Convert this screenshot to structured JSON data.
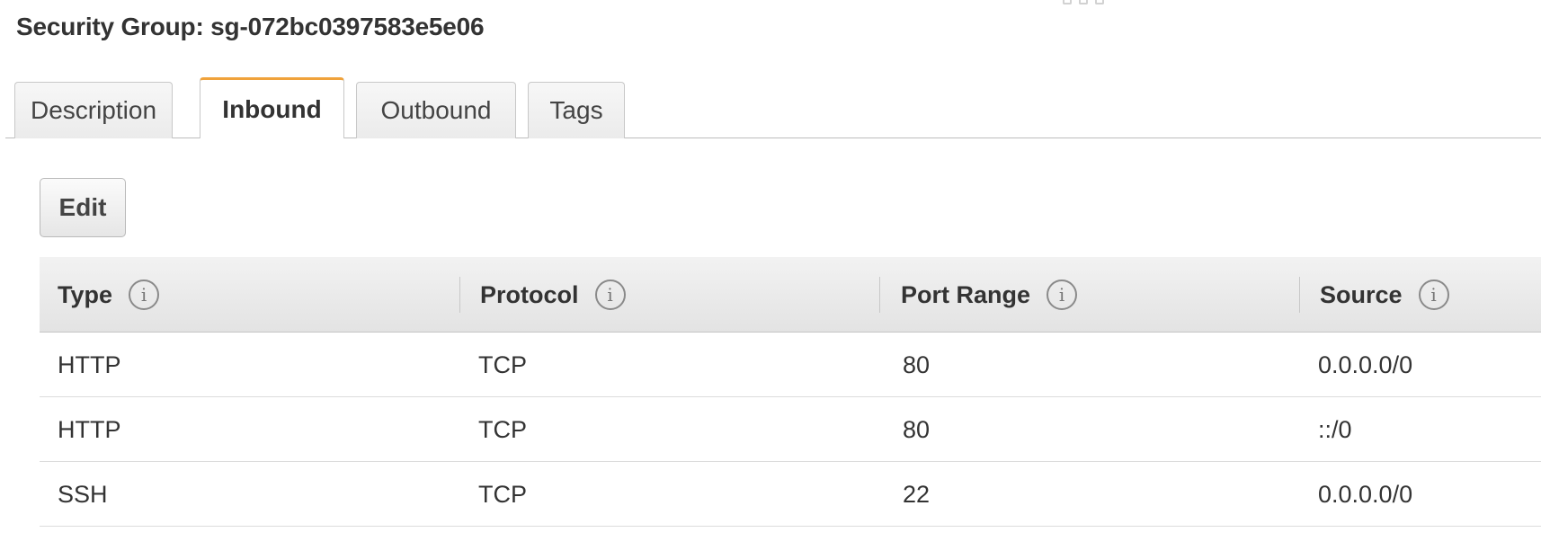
{
  "page": {
    "title": "Security Group: sg-072bc0397583e5e06"
  },
  "tabs": [
    {
      "label": "Description",
      "active": false
    },
    {
      "label": "Inbound",
      "active": true
    },
    {
      "label": "Outbound",
      "active": false
    },
    {
      "label": "Tags",
      "active": false
    }
  ],
  "toolbar": {
    "edit_label": "Edit"
  },
  "table": {
    "columns": [
      {
        "label": "Type",
        "icon": "info-icon"
      },
      {
        "label": "Protocol",
        "icon": "info-icon"
      },
      {
        "label": "Port Range",
        "icon": "info-icon"
      },
      {
        "label": "Source",
        "icon": "info-icon"
      }
    ],
    "rows": [
      [
        "HTTP",
        "TCP",
        "80",
        "0.0.0.0/0"
      ],
      [
        "HTTP",
        "TCP",
        "80",
        "::/0"
      ],
      [
        "SSH",
        "TCP",
        "22",
        "0.0.0.0/0"
      ]
    ]
  },
  "colors": {
    "active_tab_accent": "#f0a23b",
    "header_bg": "#e3e3e3",
    "text": "#333333"
  }
}
